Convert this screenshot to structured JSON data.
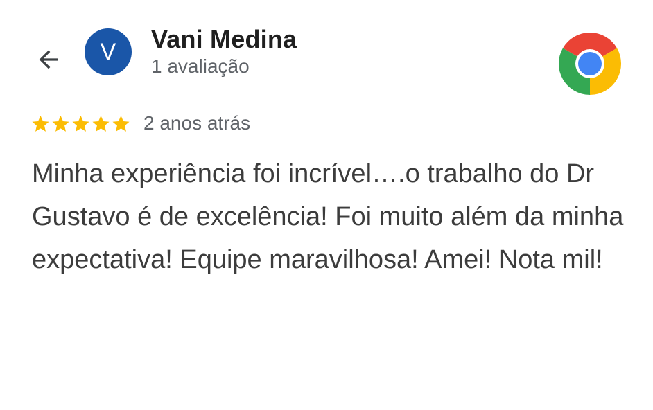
{
  "reviewer": {
    "avatar_letter": "V",
    "avatar_color": "#1a56a8",
    "name": "Vani Medina",
    "review_count": "1 avaliação"
  },
  "review": {
    "rating": 5,
    "rating_max": 5,
    "star_color": "#fbbc04",
    "time": "2 anos atrás",
    "text": "Minha experiência foi incrível….o trabalho do Dr Gustavo é de excelência! Foi muito além da minha expectativa! Equipe maravilhosa! Amei! Nota mil!"
  },
  "icons": {
    "back": "arrow-back-icon",
    "app": "chrome-icon"
  }
}
